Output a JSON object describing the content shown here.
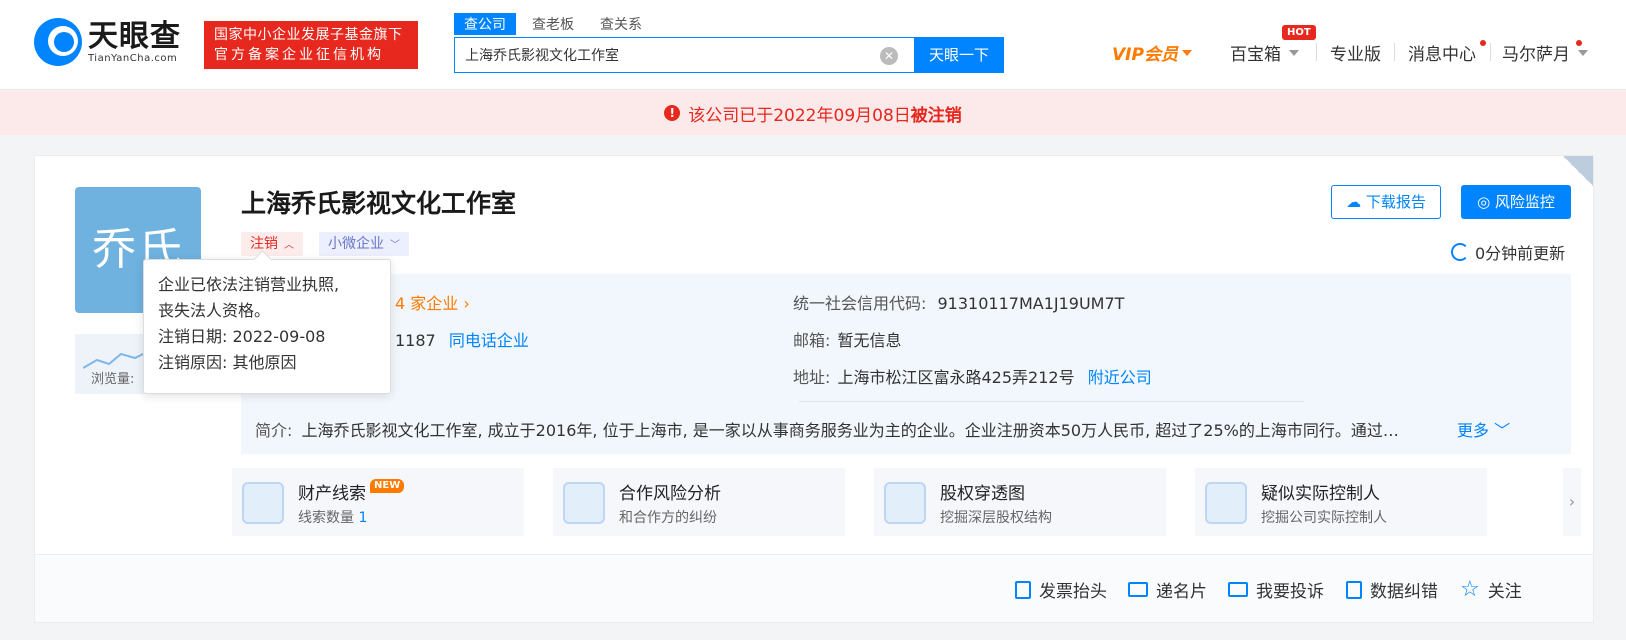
{
  "header": {
    "logo_cn": "天眼查",
    "logo_en": "TianYanCha.com",
    "gov_badge_line1": "国家中小企业发展子基金旗下",
    "gov_badge_line2": "官方备案企业征信机构",
    "search_tabs": [
      "查公司",
      "查老板",
      "查关系"
    ],
    "search_value": "上海乔氏影视文化工作室",
    "search_button": "天眼一下",
    "nav": {
      "vip": "VIP会员",
      "treasure": "百宝箱",
      "hot_badge": "HOT",
      "pro": "专业版",
      "messages": "消息中心",
      "user": "马尔萨月"
    }
  },
  "alert": {
    "prefix": "该公司已于2022年09月08日",
    "status": "被注销",
    "color": "#e6281e"
  },
  "company": {
    "avatar_text": "乔氏",
    "views_label": "浏览量:",
    "name": "上海乔氏影视文化工作室",
    "tag_status": "注销",
    "tag_scale": "小微企业",
    "download_report": "下载报告",
    "risk_monitor": "风险监控",
    "updated": "0分钟前更新",
    "related_companies": "4 家企业",
    "phone_fragment": "1187",
    "same_phone_link": "同电话企业",
    "credit_code_label": "统一社会信用代码:",
    "credit_code": "91310117MA1J19UM7T",
    "email_label": "邮箱:",
    "email": "暂无信息",
    "address_label": "地址:",
    "address": "上海市松江区富永路425弄212号",
    "nearby_link": "附近公司",
    "summary_label": "简介:",
    "summary": "上海乔氏影视文化工作室, 成立于2016年, 位于上海市, 是一家以从事商务服务业为主的企业。企业注册资本50万人民币, 超过了25%的上海市同行。通过…",
    "more": "更多"
  },
  "tooltip": {
    "line1": "企业已依法注销营业执照,",
    "line2": "丧失法人资格。",
    "date_label": "注销日期:",
    "date": "2022-09-08",
    "reason_label": "注销原因:",
    "reason": "其他原因"
  },
  "features": [
    {
      "title": "财产线索",
      "badge": "NEW",
      "sub": "线索数量",
      "count": "1"
    },
    {
      "title": "合作风险分析",
      "sub": "和合作方的纠纷"
    },
    {
      "title": "股权穿透图",
      "sub": "挖掘深层股权结构"
    },
    {
      "title": "疑似实际控制人",
      "sub": "挖掘公司实际控制人"
    }
  ],
  "actions": [
    "发票抬头",
    "递名片",
    "我要投诉",
    "数据纠错",
    "关注"
  ],
  "colors": {
    "brand": "#0084ff",
    "vip": "#ff7a00",
    "danger": "#e6281e"
  }
}
